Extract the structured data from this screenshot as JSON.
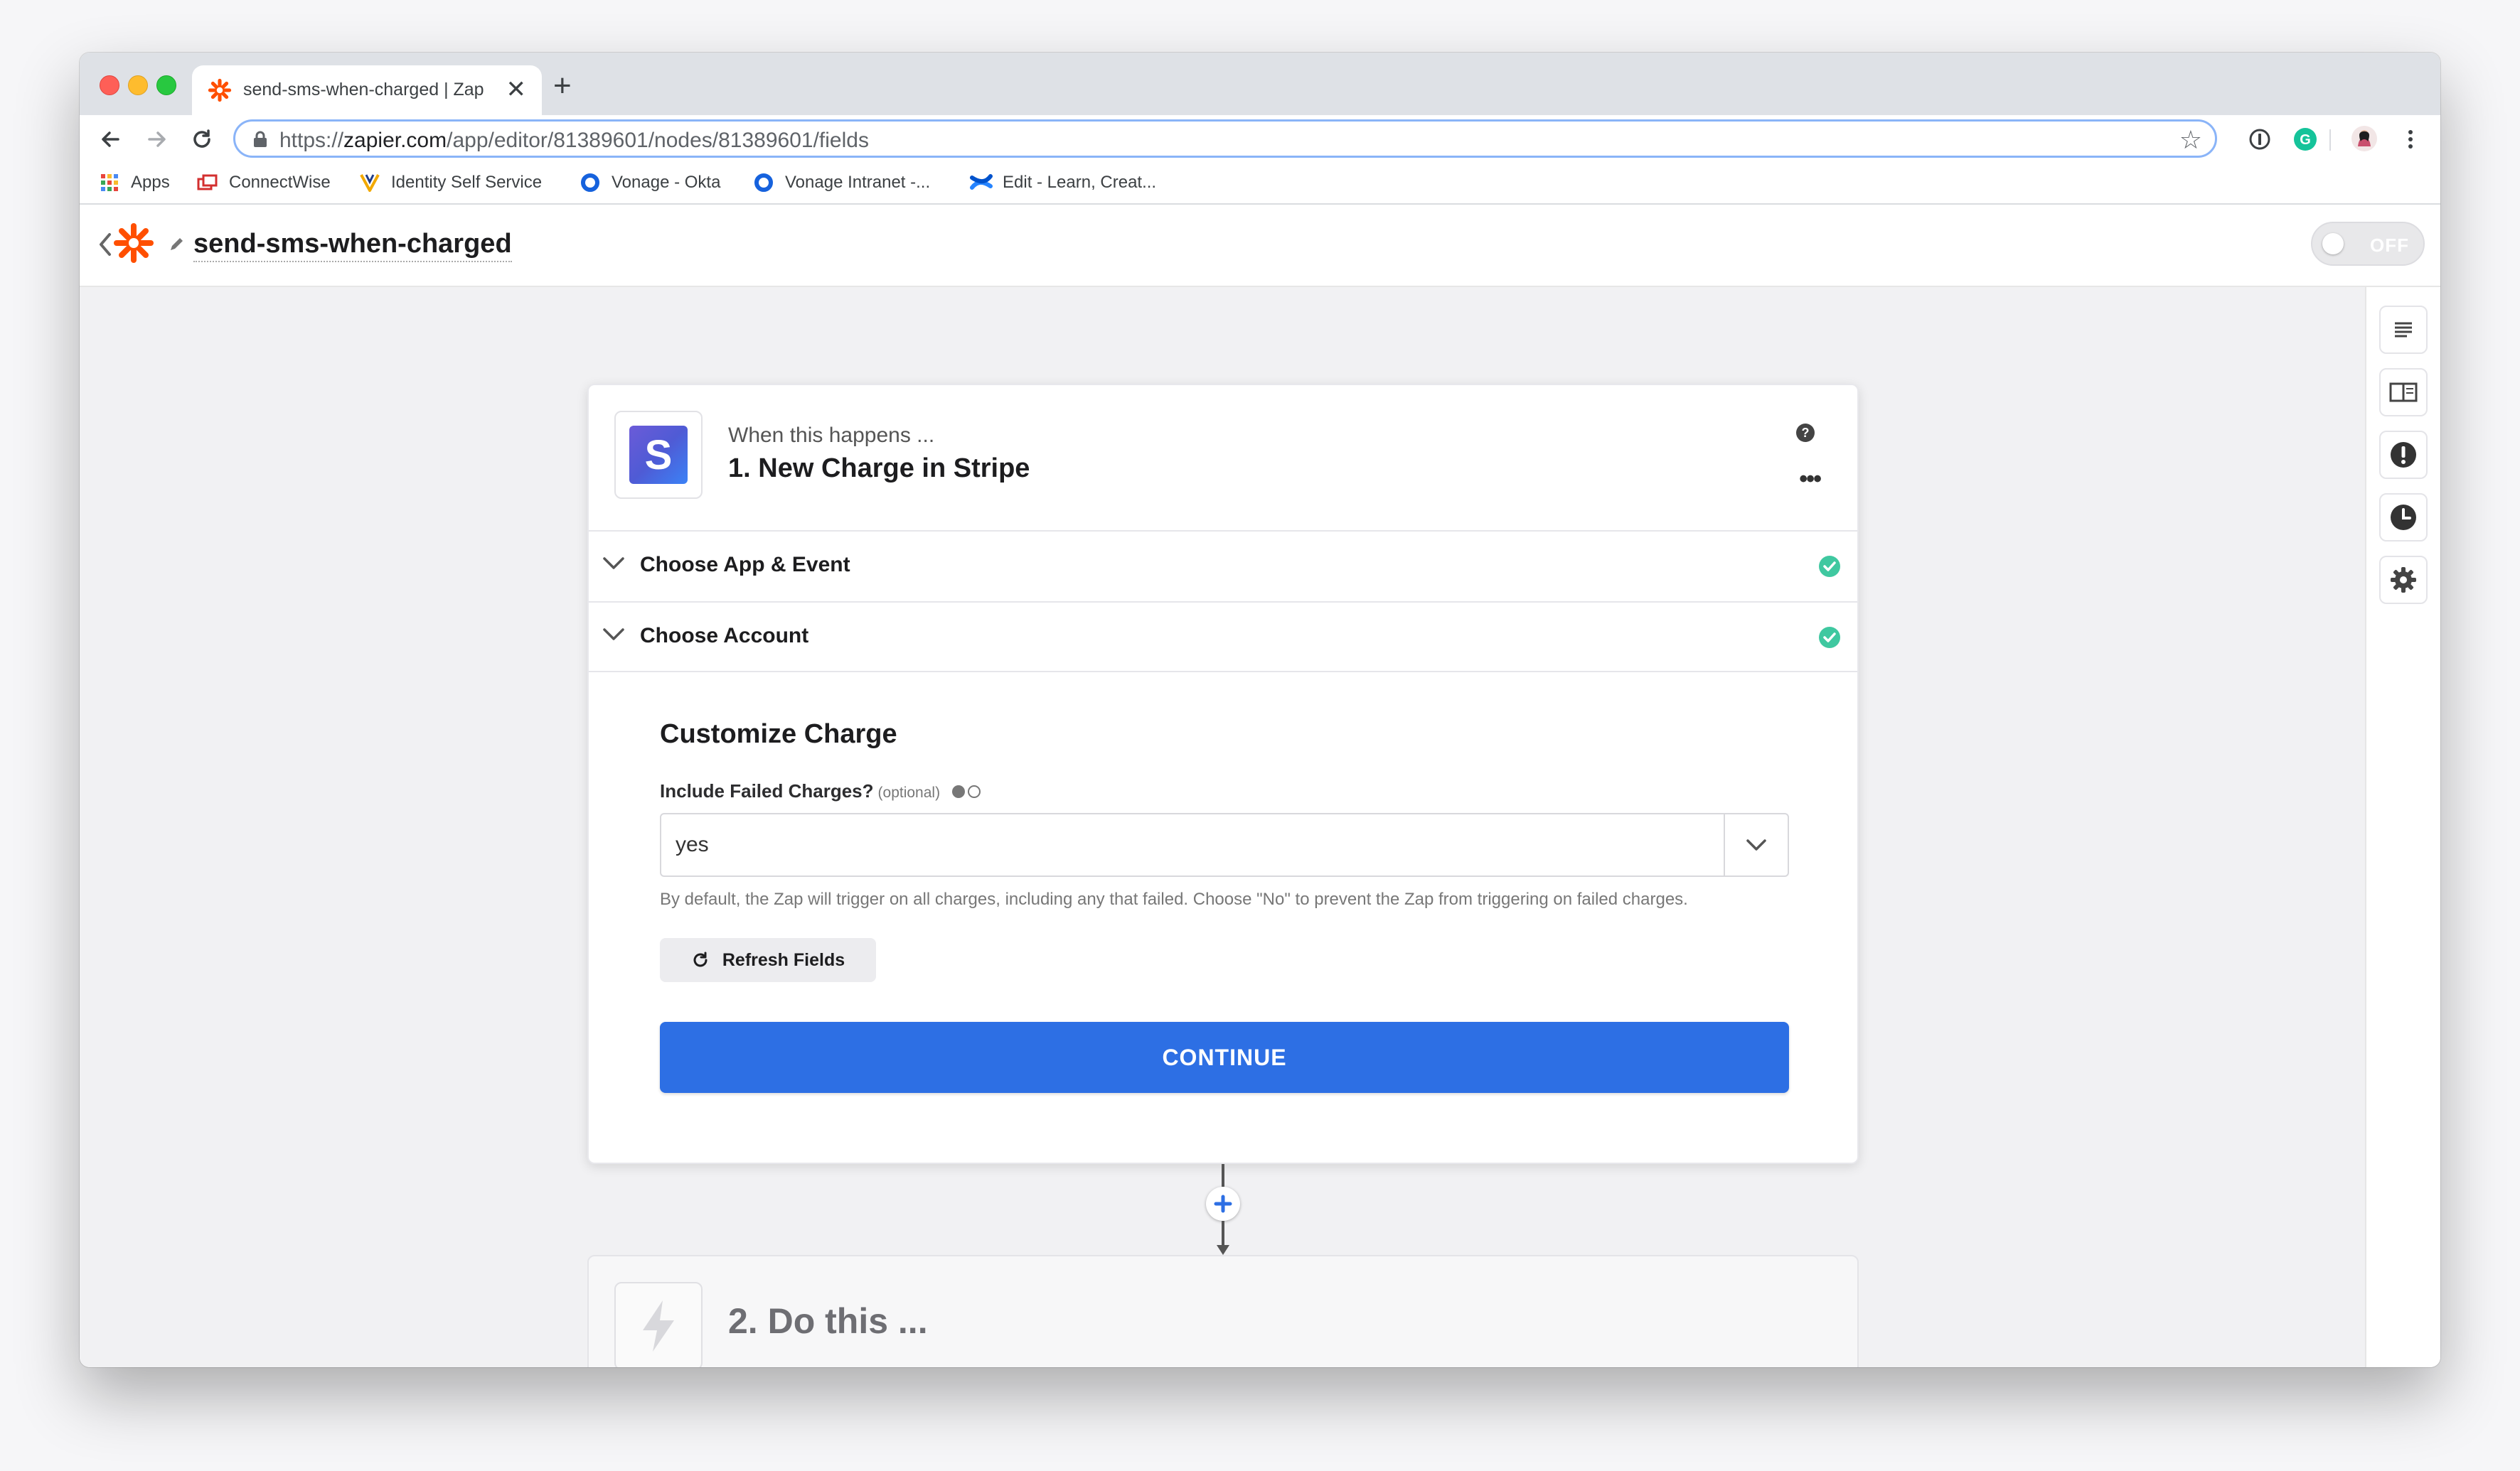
{
  "browser": {
    "tab": {
      "title": "send-sms-when-charged | Zap",
      "close": "✕"
    },
    "new_tab": "+",
    "address": {
      "scheme": "https://",
      "host": "zapier.com",
      "path": "/app/editor/81389601/nodes/81389601/fields"
    },
    "star": "☆",
    "bookmarks": [
      {
        "label": "Apps",
        "icon": "apps-grid-icon"
      },
      {
        "label": "ConnectWise",
        "icon": "connectwise-icon"
      },
      {
        "label": "Identity Self Service",
        "icon": "identity-icon"
      },
      {
        "label": "Vonage - Okta",
        "icon": "okta-icon"
      },
      {
        "label": "Vonage Intranet -...",
        "icon": "okta-icon"
      },
      {
        "label": "Edit - Learn, Creat...",
        "icon": "confluence-icon"
      }
    ]
  },
  "header": {
    "zap_name": "send-sms-when-charged",
    "toggle_label": "OFF"
  },
  "step1": {
    "when_label": "When this happens ...",
    "title": "1. New Charge in Stripe",
    "app_letter": "S",
    "more": "•••",
    "sections": [
      {
        "label": "Choose App & Event",
        "status": "complete"
      },
      {
        "label": "Choose Account",
        "status": "complete"
      }
    ],
    "customize": {
      "title": "Customize Charge",
      "field_label": "Include Failed Charges?",
      "field_optional": "(optional)",
      "select_value": "yes",
      "help_text": "By default, the Zap will trigger on all charges, including any that failed. Choose \"No\" to prevent the Zap from triggering on failed charges.",
      "refresh_label": "Refresh Fields",
      "continue_label": "CONTINUE"
    }
  },
  "step2": {
    "title": "2. Do this ..."
  },
  "colors": {
    "accent": "#2d6fe4",
    "success": "#3fc8a0",
    "zapier_orange": "#ff4f00"
  }
}
